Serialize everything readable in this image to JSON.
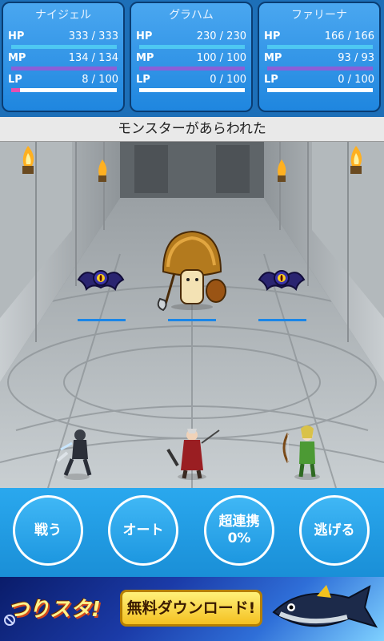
{
  "party": [
    {
      "name": "ナイジェル",
      "hp": "333 / 333",
      "mp": "134 / 134",
      "lp": "8 / 100",
      "hp_frac": 1.0,
      "mp_frac": 1.0,
      "lp_frac": 0.08
    },
    {
      "name": "グラハム",
      "hp": "230 / 230",
      "mp": "100 / 100",
      "lp": "0 / 100",
      "hp_frac": 1.0,
      "mp_frac": 1.0,
      "lp_frac": 0.0
    },
    {
      "name": "ファリーナ",
      "hp": "166 / 166",
      "mp": "93 / 93",
      "lp": "0 / 100",
      "hp_frac": 1.0,
      "mp_frac": 1.0,
      "lp_frac": 0.0
    }
  ],
  "labels": {
    "hp": "HP",
    "mp": "MP",
    "lp": "LP"
  },
  "colors": {
    "hp": "#4ec8f2",
    "mp": "#8a5fd8",
    "lp": "#e64fb0",
    "enemy_hp": "#1a86e8"
  },
  "message": "モンスターがあらわれた",
  "enemies": [
    {
      "name": "bat-monster-left",
      "hp_frac": 1.0
    },
    {
      "name": "mushroom-monster",
      "hp_frac": 1.0
    },
    {
      "name": "bat-monster-right",
      "hp_frac": 1.0
    }
  ],
  "commands": {
    "fight": "戦う",
    "auto": "オート",
    "combo_line1": "超連携",
    "combo_line2": "0%",
    "escape": "逃げる"
  },
  "ad": {
    "logo": "つりスタ!",
    "button": "無料ダウンロード!"
  }
}
